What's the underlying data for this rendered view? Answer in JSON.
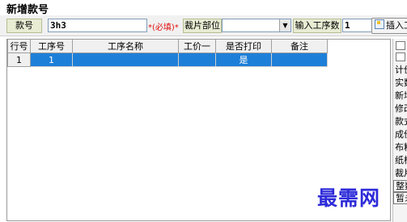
{
  "window": {
    "title": "新增款号"
  },
  "toolbar": {
    "style_label": "款号",
    "style_value": "3h3",
    "required_note": "*(必填)*",
    "cut_part_label": "裁片部位",
    "cut_part_value": "",
    "input_count_label": "输入工序数",
    "input_count_value": "1",
    "insert_button_label": "插入工"
  },
  "grid": {
    "columns": [
      "行号",
      "工序号",
      "工序名称",
      "工价一",
      "是否打印",
      "备注"
    ],
    "rows": [
      {
        "row_no": "1",
        "process_no": "1",
        "process_name": "",
        "price": "",
        "print": "是",
        "remark": ""
      }
    ]
  },
  "right_panel": {
    "items": [
      "计价",
      "实数",
      "新增",
      "修改",
      "款式",
      "成份",
      "布料",
      "纸样",
      "裁片",
      "整数",
      "暂未"
    ]
  },
  "watermark": {
    "text": "最需网"
  },
  "colors": {
    "selection": "#1e7fd8",
    "label_bg": "#e8ecd3",
    "required": "#e01010",
    "watermark": "#2d2bd8"
  }
}
